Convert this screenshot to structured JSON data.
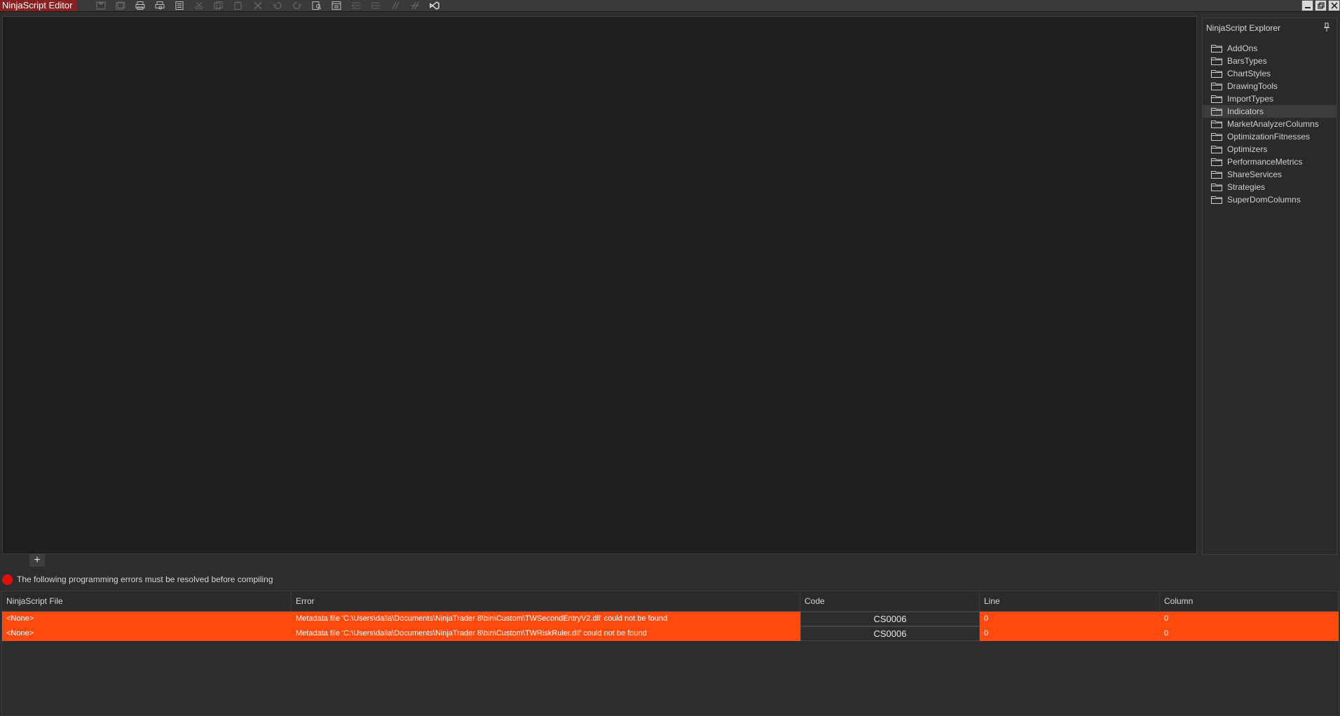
{
  "window": {
    "title": "NinjaScript Editor"
  },
  "toolbar": {
    "icons": [
      "save-icon",
      "save-all-icon",
      "print-icon",
      "print-preview-icon",
      "document-icon",
      "cut-icon",
      "copy-icon",
      "paste-icon",
      "delete-icon",
      "undo-icon",
      "redo-icon",
      "find-icon",
      "compile-icon",
      "outdent-icon",
      "indent-icon",
      "comment-icon",
      "uncomment-icon",
      "visual-studio-icon"
    ]
  },
  "explorer": {
    "title": "NinjaScript Explorer",
    "items": [
      {
        "label": "AddOns"
      },
      {
        "label": "BarsTypes"
      },
      {
        "label": "ChartStyles"
      },
      {
        "label": "DrawingTools"
      },
      {
        "label": "ImportTypes"
      },
      {
        "label": "Indicators",
        "selected": true
      },
      {
        "label": "MarketAnalyzerColumns"
      },
      {
        "label": "OptimizationFitnesses"
      },
      {
        "label": "Optimizers"
      },
      {
        "label": "PerformanceMetrics"
      },
      {
        "label": "ShareServices"
      },
      {
        "label": "Strategies"
      },
      {
        "label": "SuperDomColumns"
      }
    ]
  },
  "add_tab": {
    "label": "+"
  },
  "errors": {
    "status": "The following programming errors must be resolved before compiling",
    "columns": [
      "NinjaScript File",
      "Error",
      "Code",
      "Line",
      "Column"
    ],
    "rows": [
      {
        "file": "<None>",
        "error": "Metadata file 'C:\\Users\\dalla\\Documents\\NinjaTrader 8\\bin\\Custom\\TWSecondEntryV2.dll' could not be found",
        "code": "CS0006",
        "line": "0",
        "column": "0"
      },
      {
        "file": "<None>",
        "error": "Metadata file 'C:\\Users\\dalla\\Documents\\NinjaTrader 8\\bin\\Custom\\TWRiskRuler.dll' could not be found",
        "code": "CS0006",
        "line": "0",
        "column": "0"
      }
    ]
  },
  "colors": {
    "error_row": "#ff4a0e",
    "title_accent": "#8a1f1f",
    "error_dot": "#e0100a"
  }
}
